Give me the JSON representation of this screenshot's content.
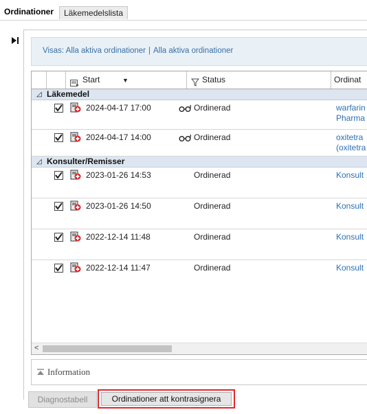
{
  "tabs": [
    {
      "label": "Ordinationer",
      "active": true
    },
    {
      "label": "Läkemedelslista",
      "active": false
    }
  ],
  "filter": {
    "part1": "Visas: Alla aktiva ordinationer",
    "separator": "|",
    "part2": "Alla aktiva ordinationer"
  },
  "grid": {
    "columns": {
      "start": "Start",
      "status": "Status",
      "ordination": "Ordinat"
    },
    "groups": [
      {
        "label": "Läkemedel",
        "rows": [
          {
            "start": "2024-04-17 17:00",
            "status": "Ordinerad",
            "ord_line1": "warfarin",
            "ord_line2": "Pharma",
            "has_glasses": true
          },
          {
            "start": "2024-04-17 14:00",
            "status": "Ordinerad",
            "ord_line1": "oxitetra",
            "ord_line2": "(oxitetra",
            "has_glasses": true
          }
        ]
      },
      {
        "label": "Konsulter/Remisser",
        "rows": [
          {
            "start": "2023-01-26 14:53",
            "status": "Ordinerad",
            "ord_line1": "Konsult"
          },
          {
            "start": "2023-01-26 14:50",
            "status": "Ordinerad",
            "ord_line1": "Konsult"
          },
          {
            "start": "2022-12-14 11:48",
            "status": "Ordinerad",
            "ord_line1": "Konsult"
          },
          {
            "start": "2022-12-14 11:47",
            "status": "Ordinerad",
            "ord_line1": "Konsult"
          }
        ]
      }
    ],
    "scroll_left": "<"
  },
  "info": {
    "label": "Information"
  },
  "buttons": {
    "diagnostabell": "Diagnostabell",
    "kontrasignera": "Ordinationer att kontrasignera"
  },
  "colors": {
    "link": "#2c6fb5",
    "group_bg": "#dde6f0",
    "filter_bg": "#e9f1f7",
    "highlight_border": "#e1262d"
  }
}
